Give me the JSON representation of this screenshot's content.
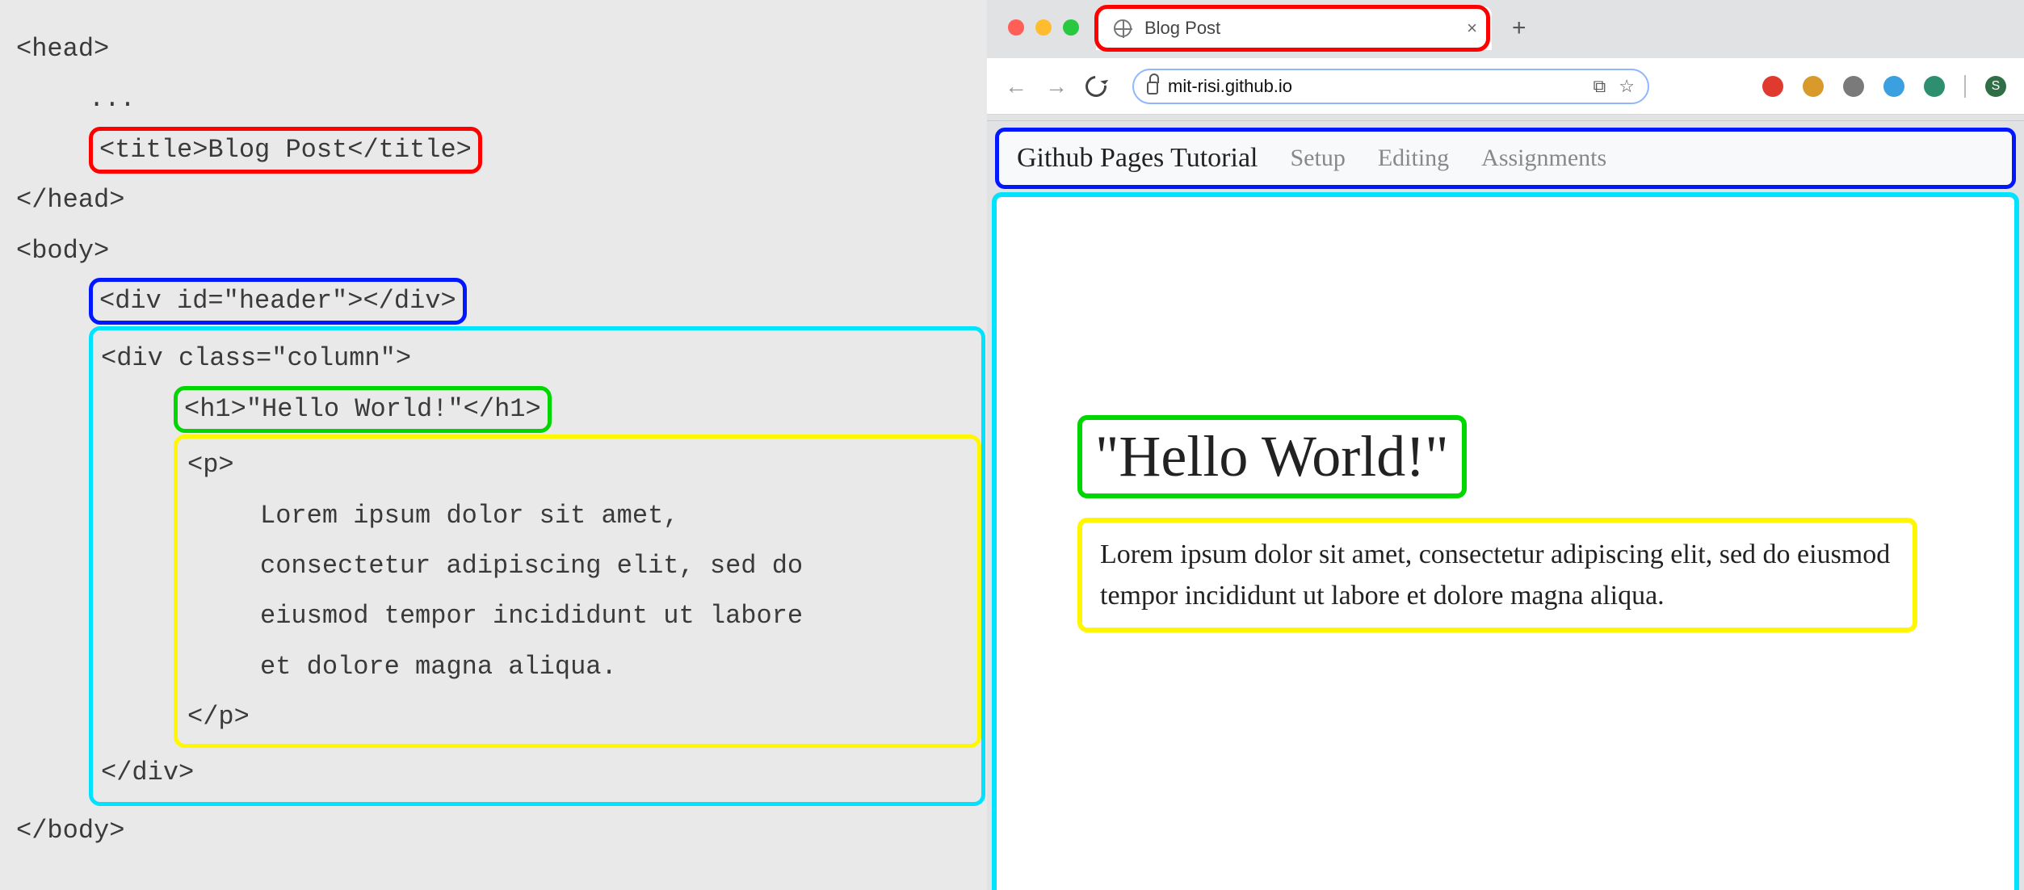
{
  "code": {
    "head_open": "<head>",
    "ellipsis": "...",
    "title_line": "<title>Blog Post</title>",
    "head_close": "</head>",
    "body_open": "<body>",
    "header_div": "<div id=\"header\"></div>",
    "col_open": "<div class=\"column\">",
    "h1_line": "<h1>\"Hello World!\"</h1>",
    "p_open": "<p>",
    "p_l1": "Lorem ipsum dolor sit amet,",
    "p_l2": "consectetur adipiscing elit, sed do",
    "p_l3": "eiusmod tempor incididunt ut labore",
    "p_l4": "et dolore magna aliqua.",
    "p_close": "</p>",
    "col_close": "</div>",
    "body_close": "</body>"
  },
  "browser": {
    "tab_title": "Blog Post",
    "new_tab_glyph": "+",
    "tab_close_glyph": "×",
    "omnibox_url": "mit-risi.github.io",
    "omni_device_glyph": "⧉",
    "omni_star_glyph": "☆"
  },
  "site": {
    "brand": "Github Pages Tutorial",
    "links": [
      "Setup",
      "Editing",
      "Assignments"
    ]
  },
  "page": {
    "heading": "\"Hello World!\"",
    "paragraph": "Lorem ipsum dolor sit amet, consectetur adipiscing elit, sed do eiusmod tempor incididunt ut labore et dolore magna aliqua."
  },
  "highlight_colors": {
    "red": "#ff0000",
    "blue": "#0017ff",
    "cyan": "#00e3ff",
    "green": "#00d600",
    "yellow": "#fff700"
  },
  "ext_icon_colors": {
    "a": "#e03a2f",
    "b": "#d89a2b",
    "c": "#7a7a7a",
    "d": "#3aa0df",
    "e": "#2d8f6f",
    "profile": "#2f6e46"
  }
}
